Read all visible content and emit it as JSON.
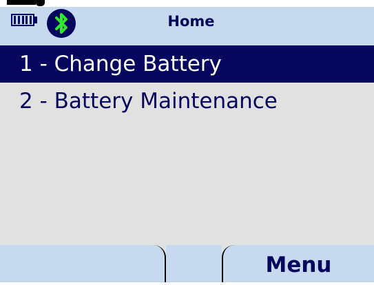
{
  "status_bar": {
    "battery_icon": "battery-full-icon",
    "bluetooth_icon": "bluetooth-icon",
    "title": "Home"
  },
  "menu": {
    "items": [
      {
        "label": "1 - Change Battery",
        "selected": true
      },
      {
        "label": "2 - Battery Maintenance",
        "selected": false
      }
    ]
  },
  "softkeys": {
    "left_label": "",
    "right_label": "Menu"
  },
  "colors": {
    "header_bg": "#c6d9ee",
    "selection_bg": "#06065e",
    "text": "#06065e",
    "screen_bg": "#e1e1e1",
    "bluetooth_green": "#2ee82e"
  }
}
